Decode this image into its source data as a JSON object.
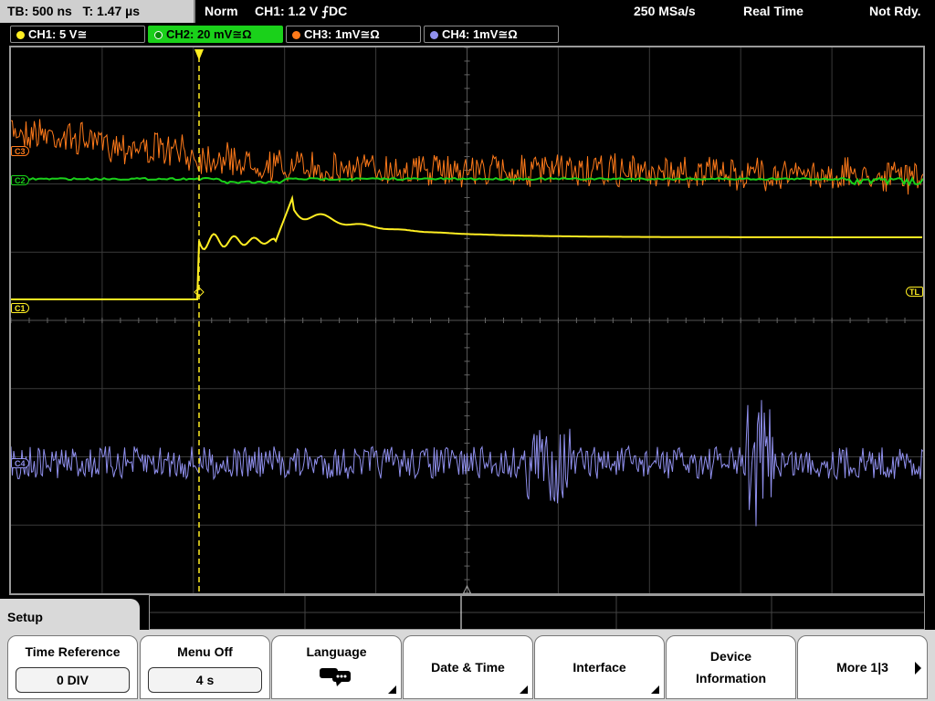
{
  "status_bar": {
    "timebase": "TB: 500 ns",
    "trigger_time": "T: 1.47 µs",
    "acq_mode": "Norm",
    "trigger_info": "CH1: 1.2 V ⨍DC",
    "sample_rate": "250 MSa/s",
    "mode": "Real Time",
    "state": "Not Rdy."
  },
  "channels": [
    {
      "label": "CH1: 5 V≅",
      "color": "#ffee22",
      "active": false
    },
    {
      "label": "CH2: 20 mV≅Ω",
      "color": "#1ad11a",
      "active": true
    },
    {
      "label": "CH3: 1mV≅Ω",
      "color": "#ff7a1a",
      "active": false
    },
    {
      "label": "CH4: 1mV≅Ω",
      "color": "#9090ee",
      "active": false
    }
  ],
  "markers": {
    "c3": "C3",
    "c2": "C2",
    "c1": "C1",
    "c4": "C4",
    "trigger_level": "TL"
  },
  "menu": {
    "title": "Setup",
    "time_reference": {
      "label": "Time Reference",
      "value": "0 DIV"
    },
    "menu_off": {
      "label": "Menu Off",
      "value": "4 s"
    },
    "language": {
      "label": "Language"
    },
    "date_time": {
      "label": "Date & Time"
    },
    "interface": {
      "label": "Interface"
    },
    "device_info": {
      "line1": "Device",
      "line2": "Information"
    },
    "more": {
      "label": "More 1|3"
    }
  },
  "colors": {
    "ch1": "#ffee22",
    "ch2": "#1ad11a",
    "ch3": "#ff7a1a",
    "ch4": "#9090ee",
    "grid": "#3a3a3a",
    "trigger": "#ffee22"
  }
}
